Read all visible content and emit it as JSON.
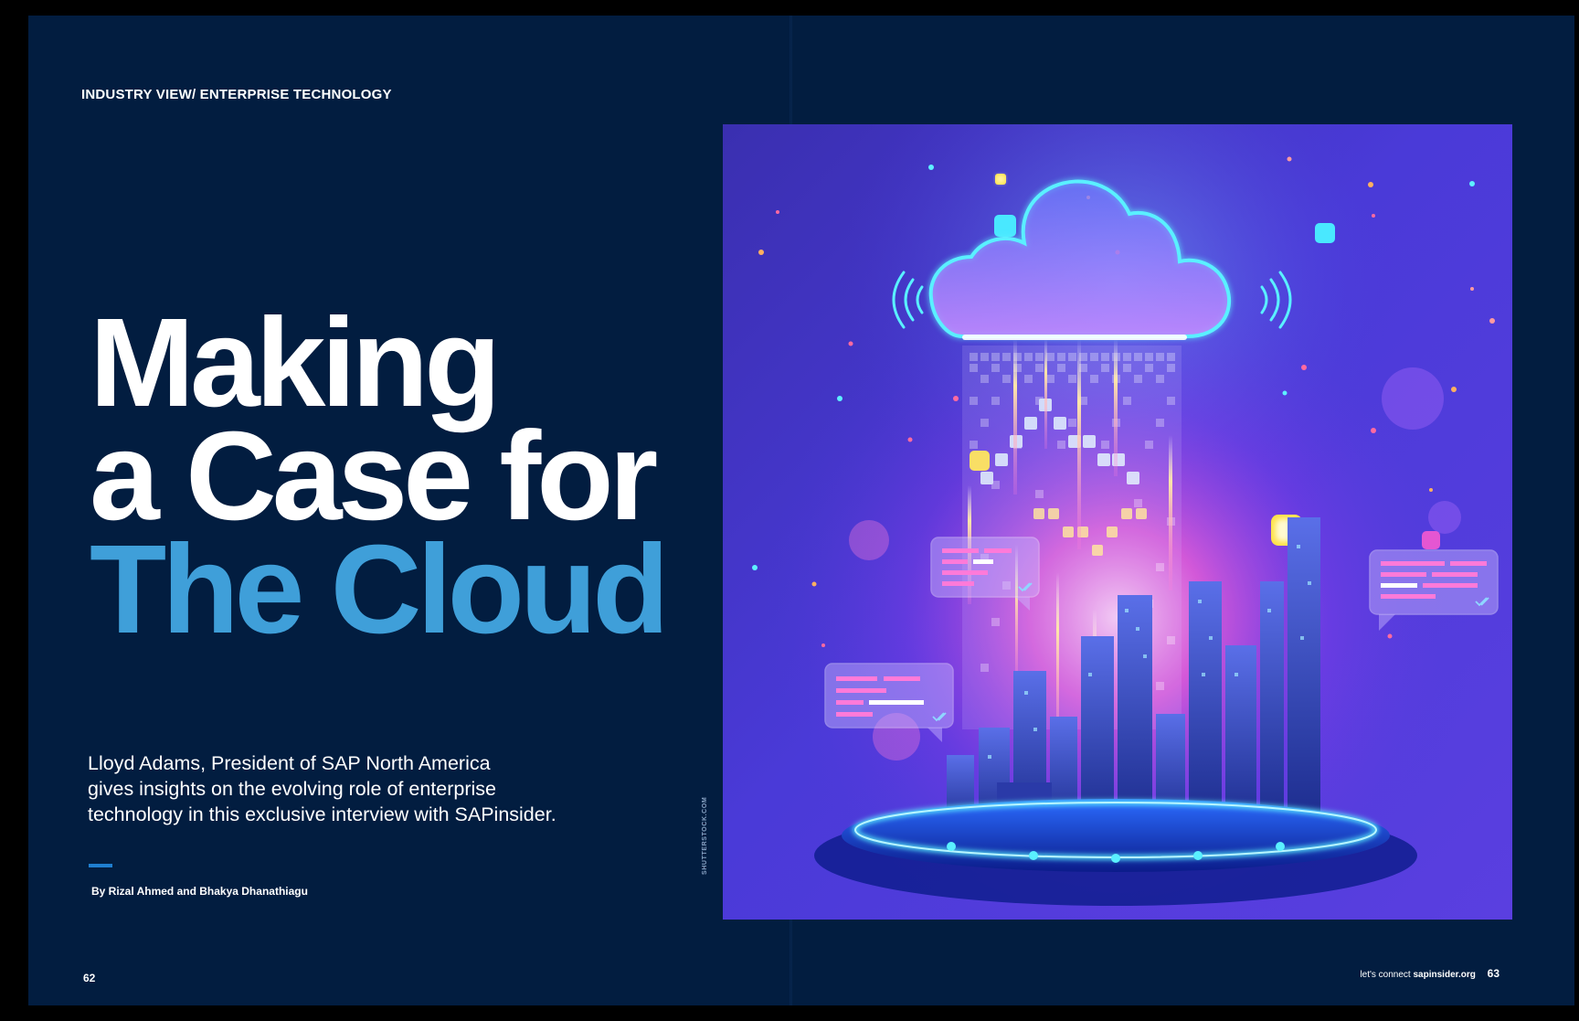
{
  "left_page": {
    "kicker": "INDUSTRY VIEW/ ENTERPRISE TECHNOLOGY",
    "headline": {
      "line1": "Making",
      "line2": "a Case for",
      "line3": "The Cloud"
    },
    "deck": {
      "line1": "Lloyd Adams, President of SAP North America",
      "line2": "gives insights on the evolving role of enterprise",
      "line3": "technology in this exclusive interview with SAPinsider."
    },
    "byline": "By Rizal Ahmed and Bhakya Dhanathiagu",
    "image_credit": "SHUTTERSTOCK.COM",
    "page_number": "62"
  },
  "right_page": {
    "footer_prefix": "let's connect",
    "footer_site": "sapinsider.org",
    "page_number": "63",
    "illustration": {
      "icons": [
        "cloud-icon",
        "city-skyline",
        "chat-bubble-icon",
        "wifi-signal-icon",
        "double-check-icon"
      ]
    }
  },
  "colors": {
    "page_background": "#021d40",
    "accent_blue": "#3f9fd9",
    "rule_blue": "#1f7fd0",
    "text": "#ffffff"
  }
}
